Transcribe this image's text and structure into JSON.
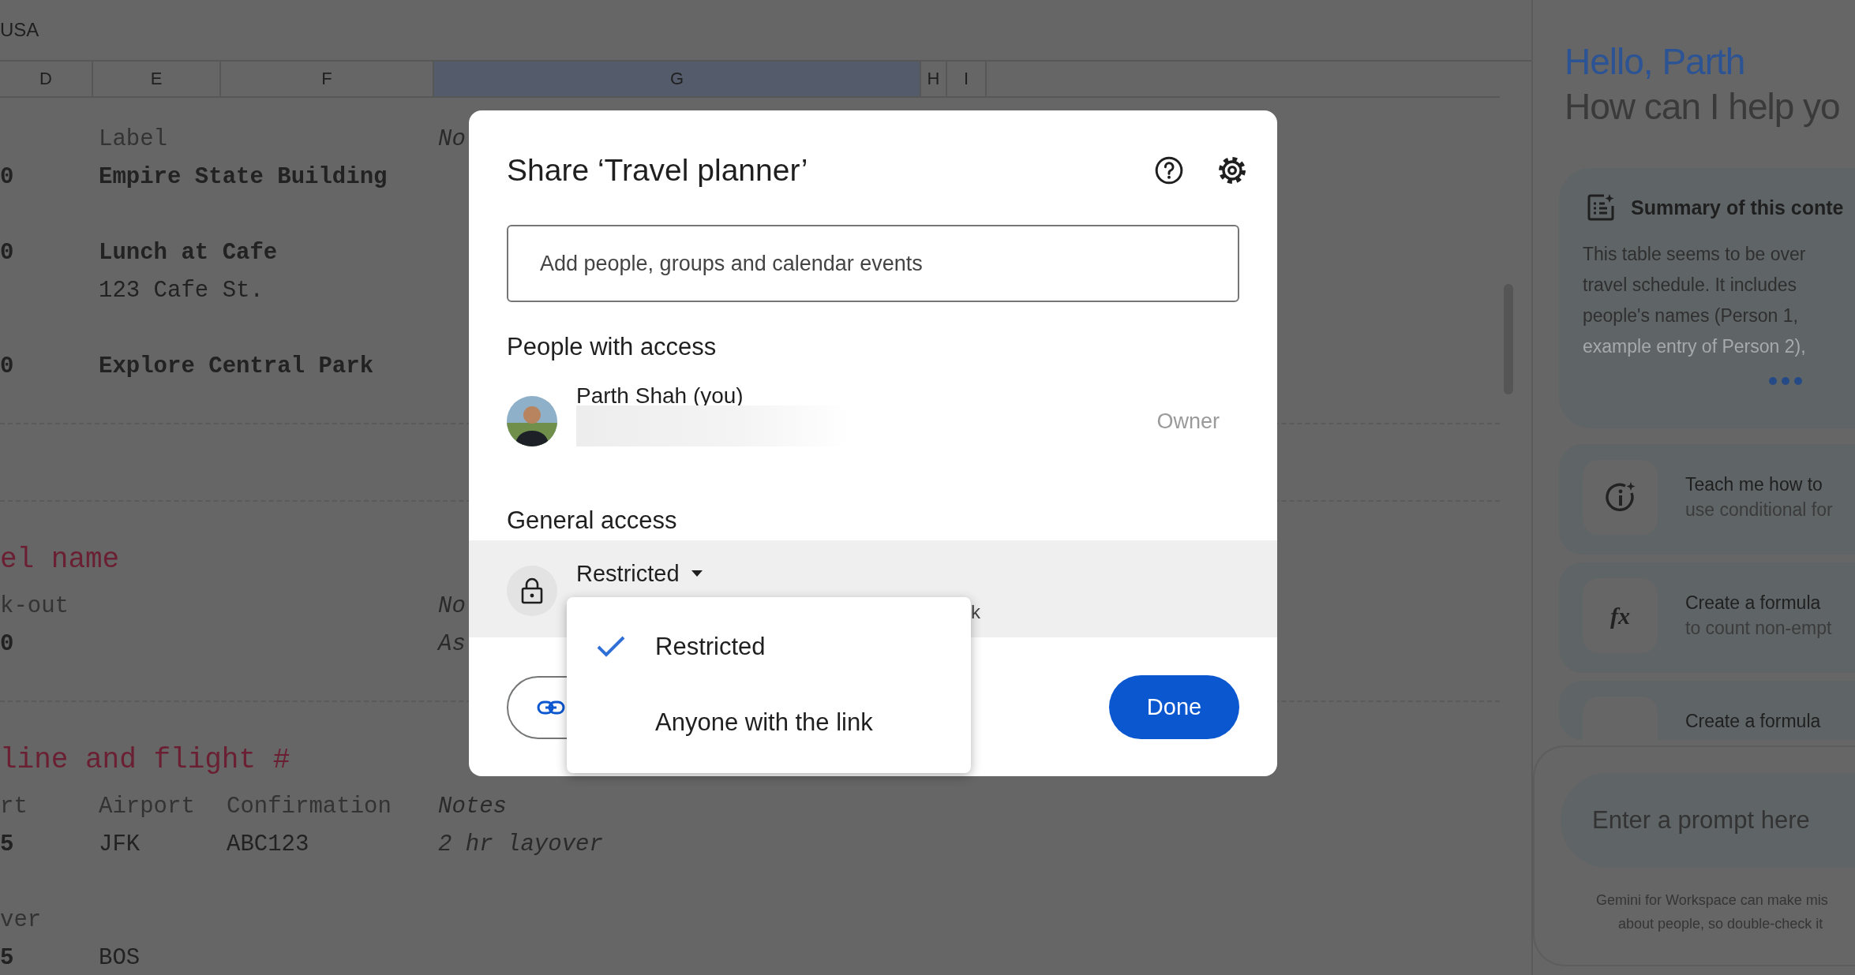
{
  "sheet": {
    "top_cell": "USA",
    "columns": [
      {
        "label": "D",
        "selected": false
      },
      {
        "label": "E",
        "selected": false
      },
      {
        "label": "F",
        "selected": false
      },
      {
        "label": "G",
        "selected": true
      },
      {
        "label": "H",
        "selected": false
      },
      {
        "label": "I",
        "selected": false
      }
    ],
    "rows": [
      {
        "kind": "cells",
        "cells": [
          null,
          {
            "text": "Label",
            "kind": "label"
          },
          null,
          {
            "text": "No",
            "kind": "note"
          }
        ]
      },
      {
        "kind": "cells",
        "cells": [
          {
            "text": "0",
            "kind": "bold"
          },
          {
            "text": "Empire State Building",
            "kind": "bold"
          },
          null,
          null
        ]
      },
      {
        "kind": "gap"
      },
      {
        "kind": "cells",
        "cells": [
          {
            "text": "0",
            "kind": "bold"
          },
          {
            "text": "Lunch at Cafe",
            "kind": "bold"
          },
          null,
          null
        ]
      },
      {
        "kind": "cells",
        "cells": [
          null,
          {
            "text": "123 Cafe St.",
            "kind": "plain"
          },
          null,
          null
        ]
      },
      {
        "kind": "gap"
      },
      {
        "kind": "cells",
        "cells": [
          {
            "text": "0",
            "kind": "bold"
          },
          {
            "text": "Explore Central Park",
            "kind": "bold"
          },
          null,
          null
        ]
      },
      {
        "kind": "gap"
      },
      {
        "kind": "divider"
      },
      {
        "kind": "gap"
      },
      {
        "kind": "gap"
      },
      {
        "kind": "divider"
      },
      {
        "kind": "title",
        "text": "el name"
      },
      {
        "kind": "cells",
        "cells": [
          {
            "text": "k-out",
            "kind": "label"
          },
          null,
          null,
          {
            "text": "No",
            "kind": "note"
          }
        ]
      },
      {
        "kind": "cells",
        "cells": [
          {
            "text": "0",
            "kind": "bold"
          },
          null,
          null,
          {
            "text": "As",
            "kind": "note"
          }
        ]
      },
      {
        "kind": "gap"
      },
      {
        "kind": "divider"
      },
      {
        "kind": "title",
        "text": "line and flight #"
      },
      {
        "kind": "cells",
        "cells": [
          {
            "text": "rt",
            "kind": "label"
          },
          {
            "text": "Airport",
            "kind": "label"
          },
          {
            "text": "Confirmation",
            "kind": "label"
          },
          {
            "text": "Notes",
            "kind": "note"
          }
        ]
      },
      {
        "kind": "cells",
        "cells": [
          {
            "text": "5",
            "kind": "bold"
          },
          {
            "text": "JFK",
            "kind": "plain"
          },
          {
            "text": "ABC123",
            "kind": "plain"
          },
          {
            "text": "2 hr layover",
            "kind": "note"
          }
        ]
      },
      {
        "kind": "gap"
      },
      {
        "kind": "cells",
        "cells": [
          {
            "text": "ver",
            "kind": "label"
          },
          null,
          null,
          null
        ]
      },
      {
        "kind": "cells",
        "cells": [
          {
            "text": "5",
            "kind": "bold"
          },
          {
            "text": "BOS",
            "kind": "plain"
          },
          null,
          null
        ]
      }
    ]
  },
  "share_dialog": {
    "title": "Share ‘Travel planner’",
    "add_field": {
      "placeholder": "Add people, groups and calendar events"
    },
    "people_heading": "People with access",
    "people": [
      {
        "name": "Parth Shah (you)",
        "role": "Owner",
        "email_redacted": true
      }
    ],
    "general_access_heading": "General access",
    "access": {
      "value": "Restricted",
      "description": "k"
    },
    "access_menu": {
      "open": true,
      "options": [
        {
          "label": "Restricted",
          "selected": true
        },
        {
          "label": "Anyone with the link",
          "selected": false
        }
      ]
    },
    "done_button": "Done"
  },
  "gemini": {
    "greeting": "Hello, Parth",
    "subtitle": "How can I help yo",
    "summary": {
      "title": "Summary of this conte",
      "lines": [
        {
          "text": "This table seems to be over",
          "faded": false
        },
        {
          "text": "travel schedule. It includes",
          "faded": false
        },
        {
          "text": "people's names (Person 1,",
          "faded": false
        },
        {
          "text": "example entry of Person 2),",
          "faded": true
        }
      ]
    },
    "suggestions": [
      {
        "kind": "info",
        "title": "Teach me how to",
        "subtitle": "use conditional for"
      },
      {
        "kind": "formula",
        "icon": "fx",
        "title": "Create a formula",
        "subtitle": "to count non-empt"
      },
      {
        "kind": "formula",
        "title": "Create a formula"
      }
    ],
    "prompt": {
      "placeholder": "Enter a prompt here"
    },
    "disclaimer": [
      "Gemini for Workspace can make mis",
      "about people, so double-check it"
    ]
  }
}
